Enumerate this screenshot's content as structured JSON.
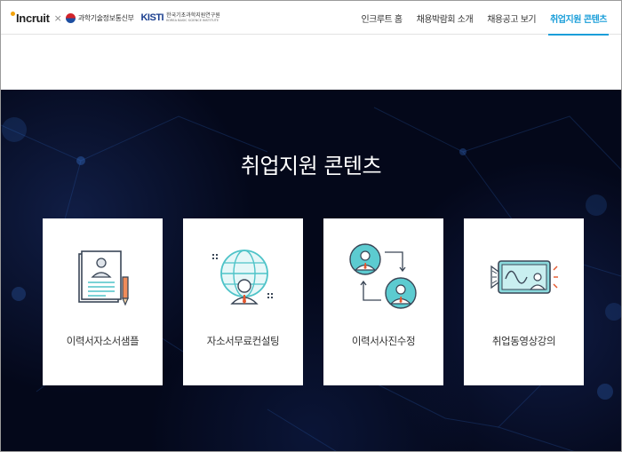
{
  "header": {
    "logo_incruit": "Incruit",
    "logo_separator": "×",
    "logo_msit": "과학기술정보통신부",
    "logo_kisti_mark": "KISTI",
    "logo_kisti_name": "한국기초과학지원연구원",
    "logo_kisti_en": "KOREA BASIC SCIENCE INSTITUTE"
  },
  "nav": [
    {
      "label": "인크루트 홈",
      "active": false
    },
    {
      "label": "채용박람회 소개",
      "active": false
    },
    {
      "label": "채용공고 보기",
      "active": false
    },
    {
      "label": "취업지원 콘텐츠",
      "active": true
    }
  ],
  "hero": {
    "title": "취업지원 콘텐츠"
  },
  "cards": [
    {
      "label": "이력서자소서샘플",
      "icon": "resume-document-icon"
    },
    {
      "label": "자소서무료컨설팅",
      "icon": "globe-consultant-icon"
    },
    {
      "label": "이력서사진수정",
      "icon": "photo-swap-icon"
    },
    {
      "label": "취업동영상강의",
      "icon": "video-lecture-icon"
    }
  ],
  "colors": {
    "accent": "#1a9ed9",
    "hero_background": "#04081a",
    "icon_teal": "#4ec3c8"
  }
}
